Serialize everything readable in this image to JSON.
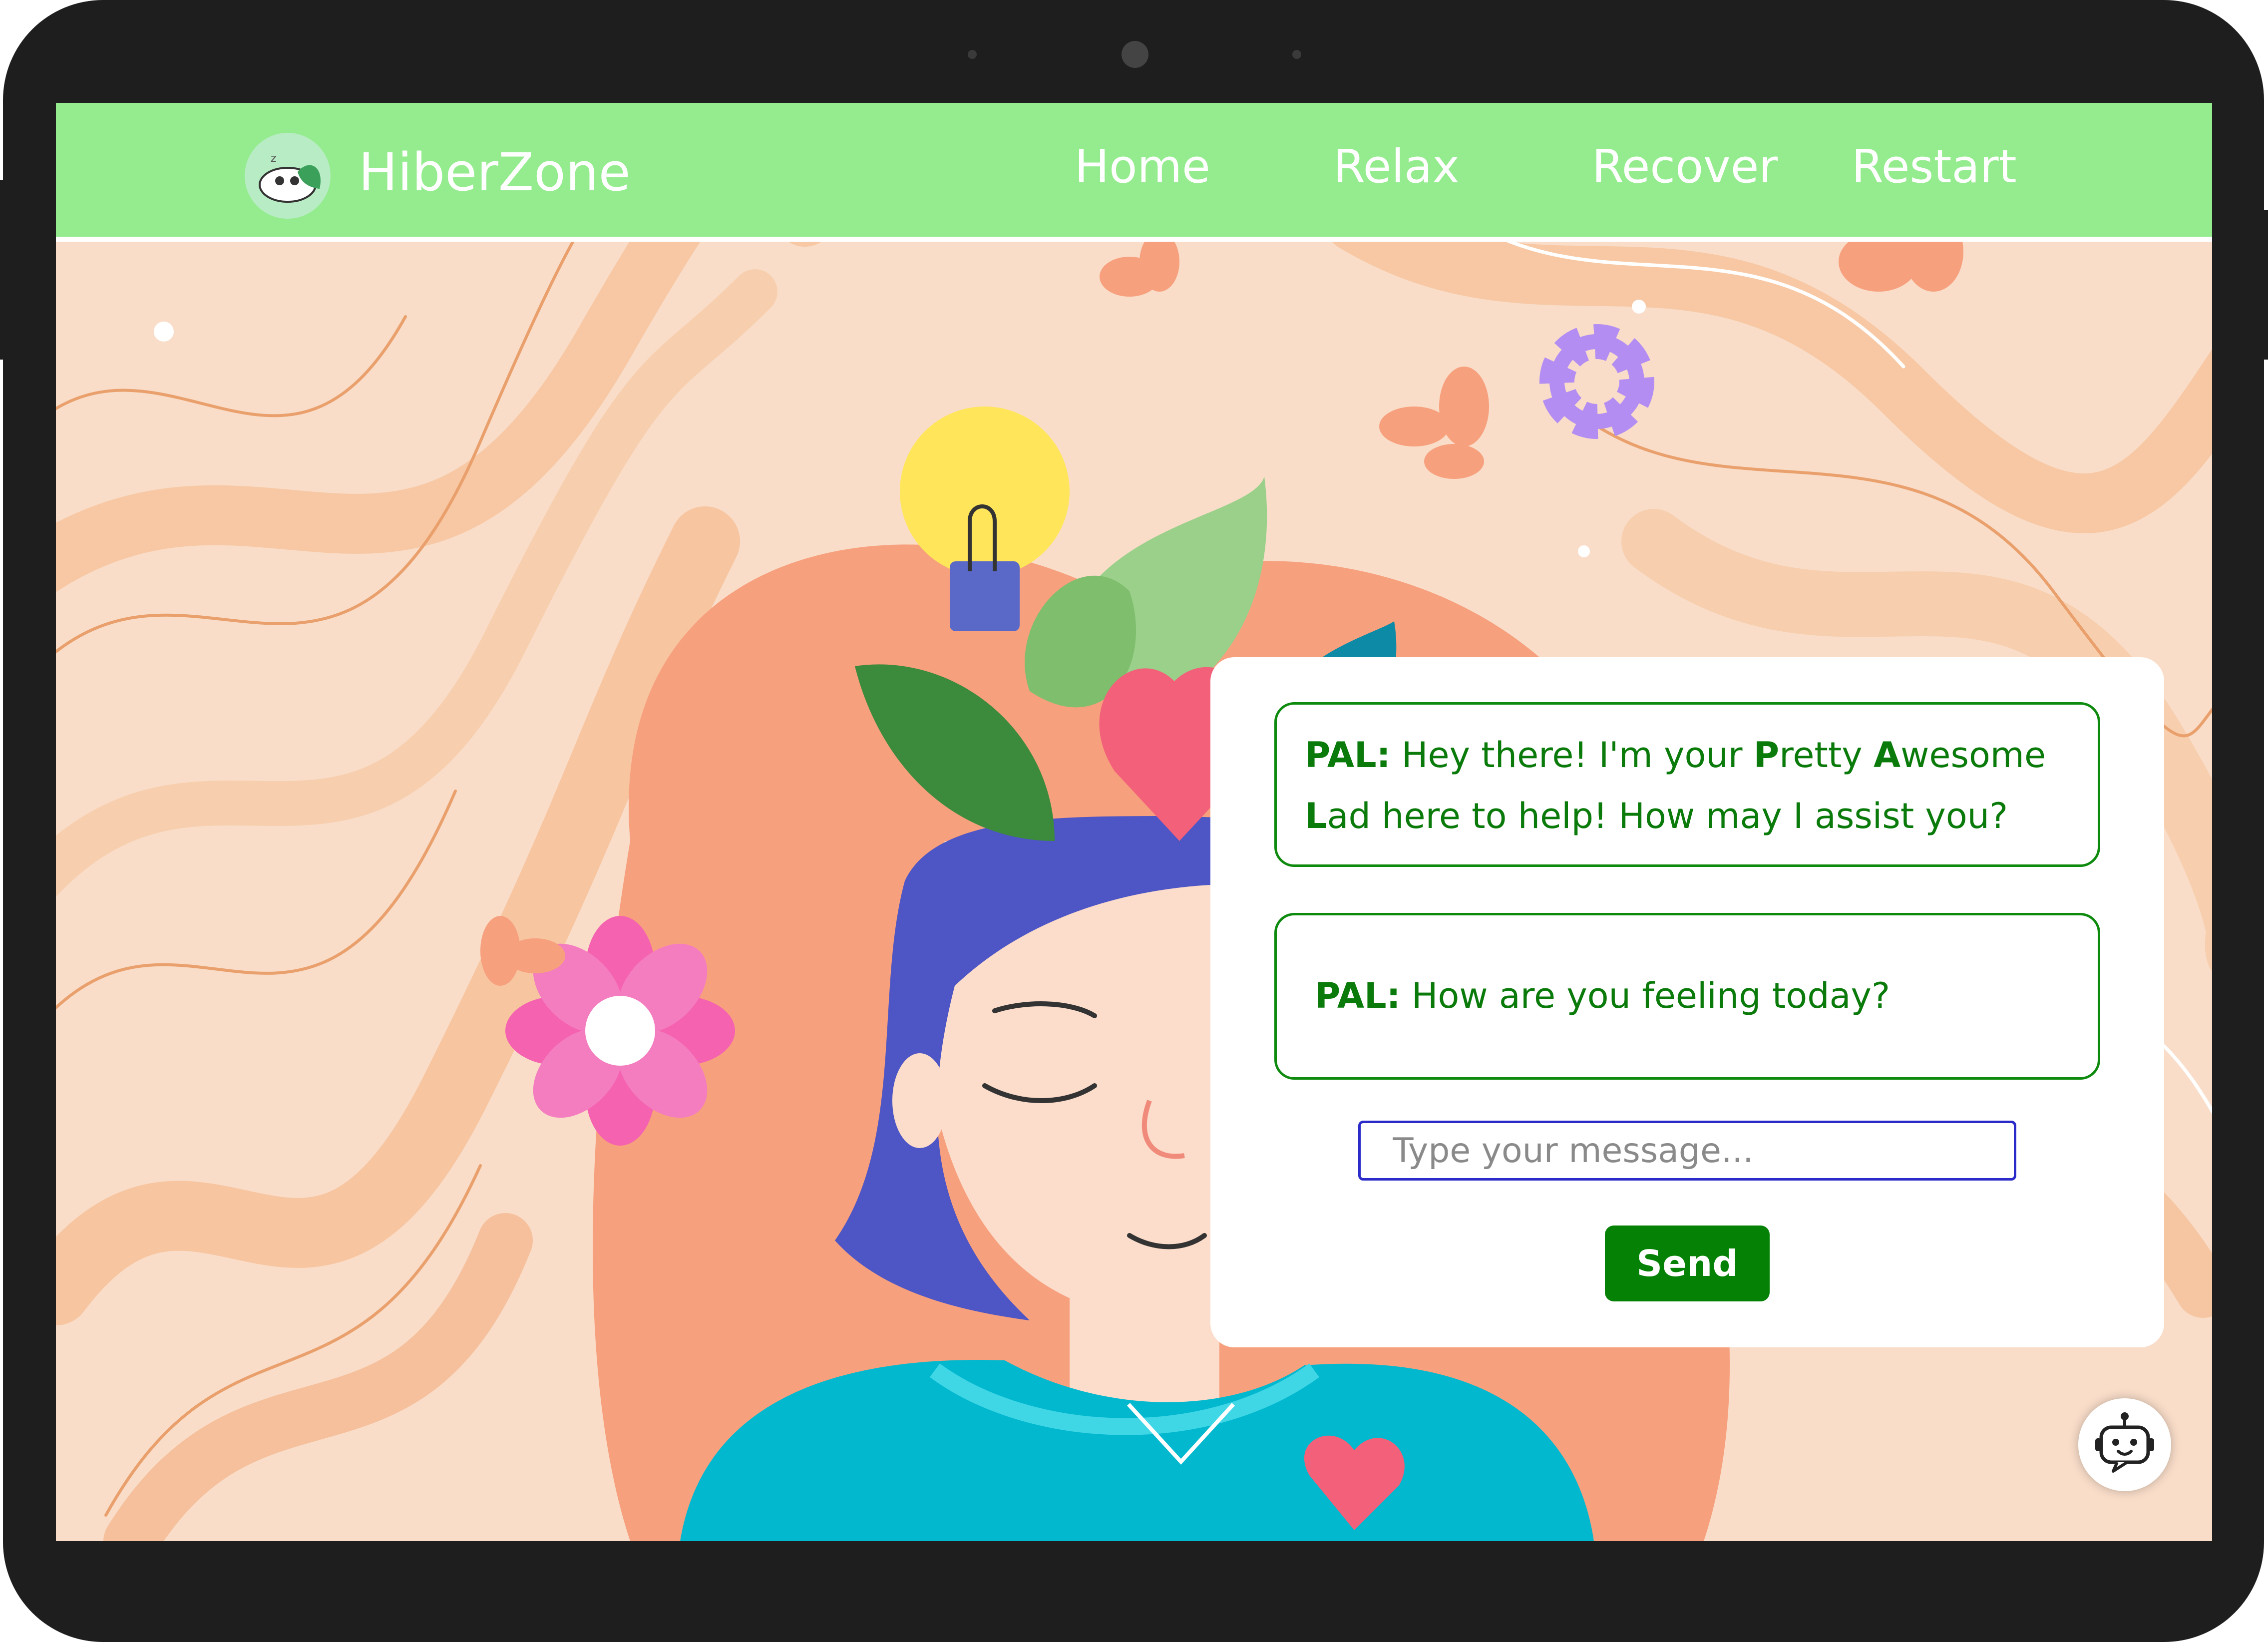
{
  "header": {
    "brand": "HiberZone",
    "nav": [
      "Home",
      "Relax",
      "Recover",
      "Restart"
    ]
  },
  "chat": {
    "messages": [
      {
        "speaker": "PAL:",
        "segments": [
          {
            "text": " Hey there! I'm your ",
            "bold": false
          },
          {
            "text": "P",
            "bold": true
          },
          {
            "text": "retty ",
            "bold": false
          },
          {
            "text": "A",
            "bold": true
          },
          {
            "text": "wesome ",
            "bold": false
          },
          {
            "text": "L",
            "bold": true
          },
          {
            "text": "ad here to help! How may I assist you?",
            "bold": false
          }
        ]
      },
      {
        "speaker": "PAL:",
        "segments": [
          {
            "text": " How are you feeling today?",
            "bold": false
          }
        ]
      }
    ],
    "input_placeholder": "Type your message...",
    "send_label": "Send"
  },
  "icons": {
    "logo": "panda-leaf-logo-icon",
    "scroll_down": "chevron-down-icon",
    "chatbot": "robot-chat-icon"
  },
  "colors": {
    "navbar": "#95ec8f",
    "hero_background": "#f9ddc9",
    "chat_text": "#0a7a0a",
    "chat_border": "#0e8a0e",
    "send_button": "#058205",
    "input_border": "#2b2bc9"
  }
}
